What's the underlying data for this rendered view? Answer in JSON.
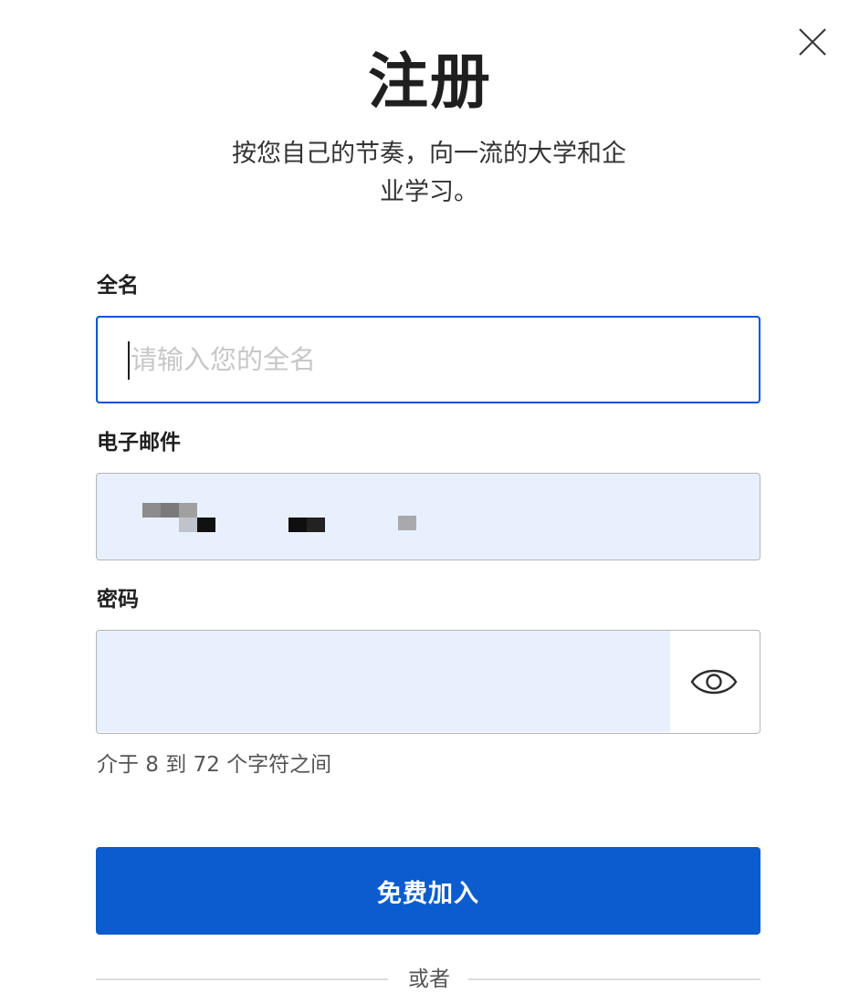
{
  "dialog": {
    "title": "注册",
    "subtitle": "按您自己的节奏，向一流的大学和企业学习。",
    "close_icon": "close-icon"
  },
  "form": {
    "full_name": {
      "label": "全名",
      "placeholder": "请输入您的全名",
      "value": ""
    },
    "email": {
      "label": "电子邮件",
      "value_redacted": true
    },
    "password": {
      "label": "密码",
      "value": "",
      "toggle_icon": "eye-icon",
      "hint": "介于 8 到 72 个字符之间"
    },
    "submit_label": "免费加入",
    "divider_label": "或者"
  },
  "colors": {
    "accent": "#0056d2",
    "button": "#0b5ccf",
    "autofill": "#e8f0fe",
    "border": "#b4b4b4"
  }
}
